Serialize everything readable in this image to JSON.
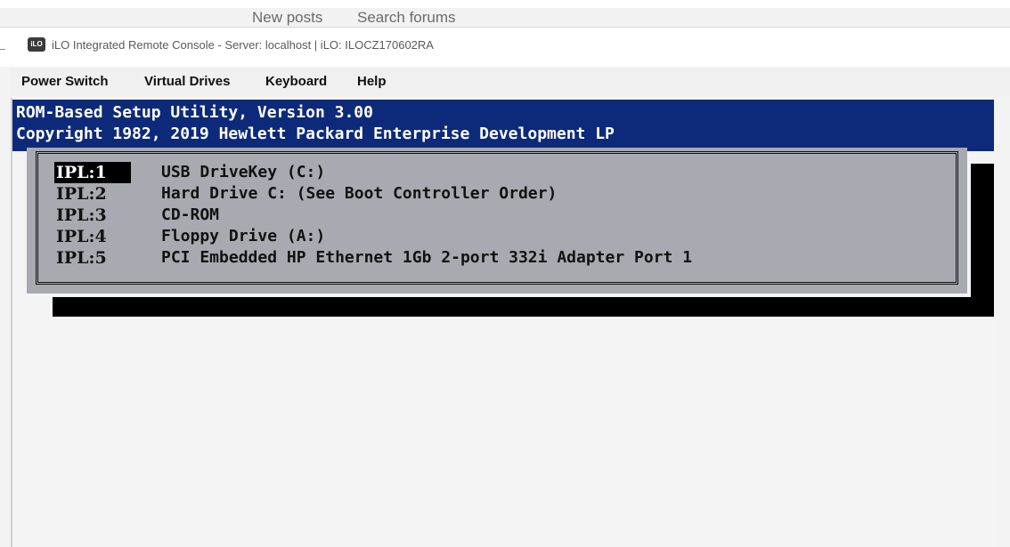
{
  "top_links": {
    "new_posts": "New posts",
    "search_forums": "Search forums"
  },
  "window": {
    "icon_text": "iLO",
    "title": "iLO Integrated Remote Console - Server: localhost | iLO: ILOCZ170602RA"
  },
  "menu": {
    "items": [
      {
        "label": "Power Switch"
      },
      {
        "label": "Virtual Drives"
      },
      {
        "label": "Keyboard"
      },
      {
        "label": "Help"
      }
    ]
  },
  "console": {
    "header_line1": "ROM-Based Setup Utility, Version 3.00",
    "header_line2": "Copyright 1982, 2019 Hewlett Packard Enterprise Development LP",
    "boot_order": [
      {
        "ipl": "IPL:1",
        "device": "USB DriveKey (C:)",
        "selected": true
      },
      {
        "ipl": "IPL:2",
        "device": "Hard Drive C: (See Boot Controller Order)",
        "selected": false
      },
      {
        "ipl": "IPL:3",
        "device": "CD-ROM",
        "selected": false
      },
      {
        "ipl": "IPL:4",
        "device": "Floppy Drive (A:)",
        "selected": false
      },
      {
        "ipl": "IPL:5",
        "device": "PCI Embedded HP Ethernet 1Gb 2-port 332i Adapter Port 1",
        "selected": false
      }
    ]
  },
  "colors": {
    "header_band": "#0d2a7a",
    "dialog_bg": "#a9a9b1",
    "selection_bg": "#000000",
    "selection_fg": "#ffffff"
  }
}
